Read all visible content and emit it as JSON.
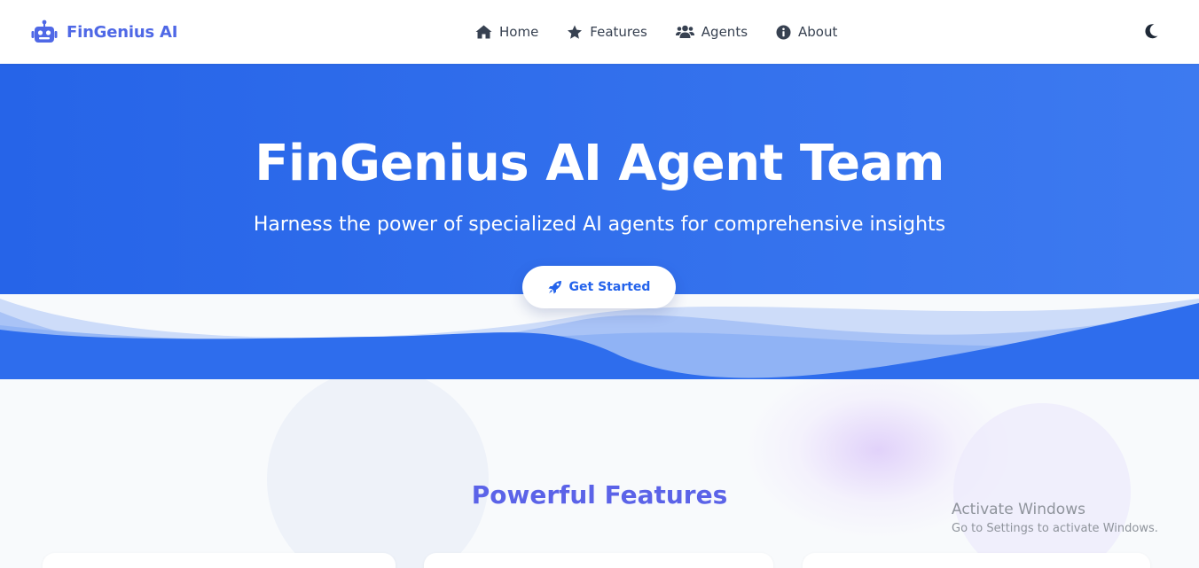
{
  "navbar": {
    "brand": "FinGenius AI",
    "brand_icon": "robot-icon",
    "links": [
      {
        "label": "Home",
        "icon": "home-icon"
      },
      {
        "label": "Features",
        "icon": "star-icon"
      },
      {
        "label": "Agents",
        "icon": "users-icon"
      },
      {
        "label": "About",
        "icon": "info-circle-icon"
      }
    ],
    "theme_toggle_icon": "moon-icon"
  },
  "hero": {
    "title": "FinGenius AI Agent Team",
    "subtitle": "Harness the power of specialized AI agents for comprehensive insights",
    "cta_label": "Get Started",
    "cta_icon": "rocket-icon"
  },
  "features": {
    "title": "Powerful Features"
  },
  "watermark": {
    "title": "Activate Windows",
    "subtitle": "Go to Settings to activate Windows."
  },
  "colors": {
    "brand": "#4f68e6",
    "hero_blue": "#2664e8",
    "features_title": "#5b63e8",
    "nav_text": "#374151"
  }
}
